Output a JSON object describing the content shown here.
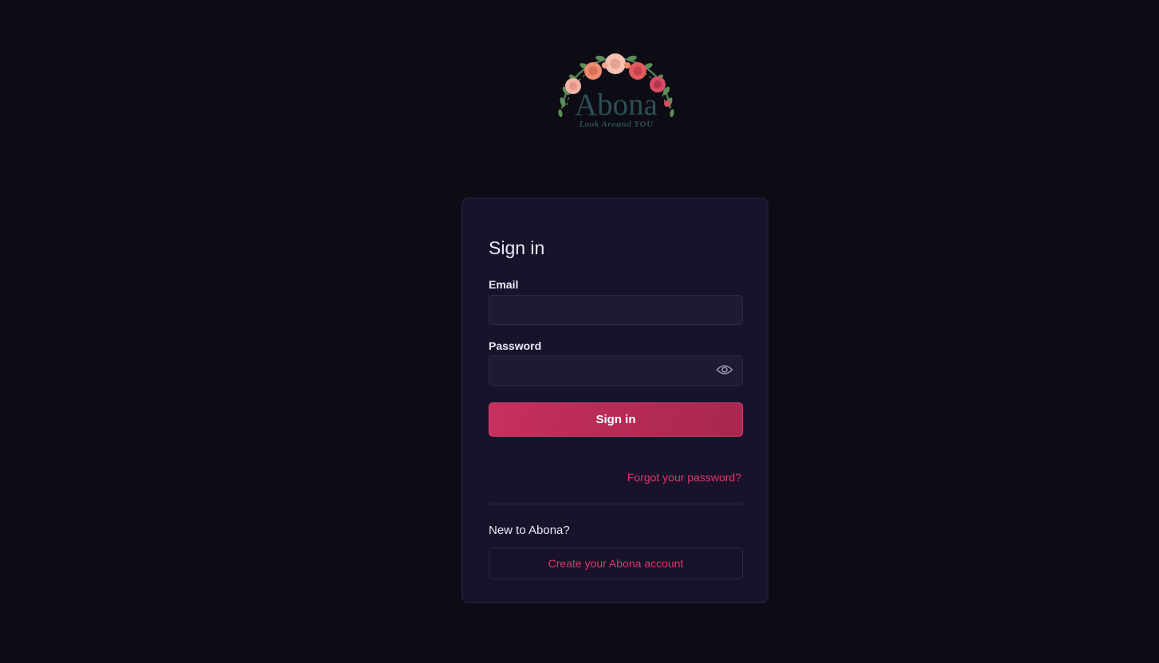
{
  "logo": {
    "name": "Abona",
    "tagline": "Look Around YOU"
  },
  "signin": {
    "title": "Sign in",
    "email_label": "Email",
    "email_value": "",
    "password_label": "Password",
    "password_value": "",
    "submit_label": "Sign in",
    "forgot_link": "Forgot your password?",
    "new_prompt": "New to Abona?",
    "create_button": "Create your Abona account",
    "password_toggle_icon": "eye-icon"
  },
  "colors": {
    "background": "#0d0b14",
    "card": "#18132a",
    "accent": "#e0366d",
    "button": "#c7305f"
  }
}
